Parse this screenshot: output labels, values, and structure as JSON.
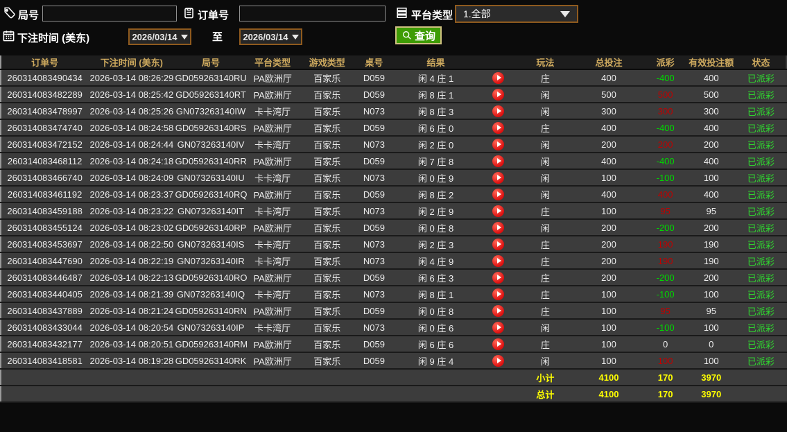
{
  "filters": {
    "round": {
      "label": "局号",
      "value": ""
    },
    "order": {
      "label": "订单号",
      "value": ""
    },
    "platform": {
      "label": "平台类型",
      "selected": "1.全部"
    },
    "bet_time": {
      "label": "下注时间 (美东)",
      "from": "2026/03/14",
      "to_label": "至",
      "to": "2026/03/14"
    },
    "search_label": "查询"
  },
  "table": {
    "columns": [
      "订单号",
      "下注时间 (美东)",
      "局号",
      "平台类型",
      "游戏类型",
      "桌号",
      "结果",
      "",
      "玩法",
      "总投注",
      "派彩",
      "有效投注额",
      "状态"
    ],
    "rows": [
      [
        "260314083490434",
        "2026-03-14 08:26:29",
        "GD059263140RU",
        "PA欧洲厅",
        "百家乐",
        "D059",
        "闲 4 庄 1",
        "庄",
        "400",
        "-400",
        "400",
        "已派彩"
      ],
      [
        "260314083482289",
        "2026-03-14 08:25:42",
        "GD059263140RT",
        "PA欧洲厅",
        "百家乐",
        "D059",
        "闲 8 庄 1",
        "闲",
        "500",
        "500",
        "500",
        "已派彩"
      ],
      [
        "260314083478997",
        "2026-03-14 08:25:26",
        "GN073263140IW",
        "卡卡湾厅",
        "百家乐",
        "N073",
        "闲 8 庄 3",
        "闲",
        "300",
        "300",
        "300",
        "已派彩"
      ],
      [
        "260314083474740",
        "2026-03-14 08:24:58",
        "GD059263140RS",
        "PA欧洲厅",
        "百家乐",
        "D059",
        "闲 6 庄 0",
        "庄",
        "400",
        "-400",
        "400",
        "已派彩"
      ],
      [
        "260314083472152",
        "2026-03-14 08:24:44",
        "GN073263140IV",
        "卡卡湾厅",
        "百家乐",
        "N073",
        "闲 2 庄 0",
        "闲",
        "200",
        "200",
        "200",
        "已派彩"
      ],
      [
        "260314083468112",
        "2026-03-14 08:24:18",
        "GD059263140RR",
        "PA欧洲厅",
        "百家乐",
        "D059",
        "闲 7 庄 8",
        "闲",
        "400",
        "-400",
        "400",
        "已派彩"
      ],
      [
        "260314083466740",
        "2026-03-14 08:24:09",
        "GN073263140IU",
        "卡卡湾厅",
        "百家乐",
        "N073",
        "闲 0 庄 9",
        "闲",
        "100",
        "-100",
        "100",
        "已派彩"
      ],
      [
        "260314083461192",
        "2026-03-14 08:23:37",
        "GD059263140RQ",
        "PA欧洲厅",
        "百家乐",
        "D059",
        "闲 8 庄 2",
        "闲",
        "400",
        "400",
        "400",
        "已派彩"
      ],
      [
        "260314083459188",
        "2026-03-14 08:23:22",
        "GN073263140IT",
        "卡卡湾厅",
        "百家乐",
        "N073",
        "闲 2 庄 9",
        "庄",
        "100",
        "95",
        "95",
        "已派彩"
      ],
      [
        "260314083455124",
        "2026-03-14 08:23:02",
        "GD059263140RP",
        "PA欧洲厅",
        "百家乐",
        "D059",
        "闲 0 庄 8",
        "闲",
        "200",
        "-200",
        "200",
        "已派彩"
      ],
      [
        "260314083453697",
        "2026-03-14 08:22:50",
        "GN073263140IS",
        "卡卡湾厅",
        "百家乐",
        "N073",
        "闲 2 庄 3",
        "庄",
        "200",
        "190",
        "190",
        "已派彩"
      ],
      [
        "260314083447690",
        "2026-03-14 08:22:19",
        "GN073263140IR",
        "卡卡湾厅",
        "百家乐",
        "N073",
        "闲 4 庄 9",
        "庄",
        "200",
        "190",
        "190",
        "已派彩"
      ],
      [
        "260314083446487",
        "2026-03-14 08:22:13",
        "GD059263140RO",
        "PA欧洲厅",
        "百家乐",
        "D059",
        "闲 6 庄 3",
        "庄",
        "200",
        "-200",
        "200",
        "已派彩"
      ],
      [
        "260314083440405",
        "2026-03-14 08:21:39",
        "GN073263140IQ",
        "卡卡湾厅",
        "百家乐",
        "N073",
        "闲 8 庄 1",
        "庄",
        "100",
        "-100",
        "100",
        "已派彩"
      ],
      [
        "260314083437889",
        "2026-03-14 08:21:24",
        "GD059263140RN",
        "PA欧洲厅",
        "百家乐",
        "D059",
        "闲 0 庄 8",
        "庄",
        "100",
        "95",
        "95",
        "已派彩"
      ],
      [
        "260314083433044",
        "2026-03-14 08:20:54",
        "GN073263140IP",
        "卡卡湾厅",
        "百家乐",
        "N073",
        "闲 0 庄 6",
        "闲",
        "100",
        "-100",
        "100",
        "已派彩"
      ],
      [
        "260314083432177",
        "2026-03-14 08:20:51",
        "GD059263140RM",
        "PA欧洲厅",
        "百家乐",
        "D059",
        "闲 6 庄 6",
        "庄",
        "100",
        "0",
        "0",
        "已派彩"
      ],
      [
        "260314083418581",
        "2026-03-14 08:19:28",
        "GD059263140RK",
        "PA欧洲厅",
        "百家乐",
        "D059",
        "闲 9 庄 4",
        "闲",
        "100",
        "100",
        "100",
        "已派彩"
      ]
    ],
    "subtotal": {
      "label": "小计",
      "total_bet": "4100",
      "payout": "170",
      "valid_bet": "3970"
    },
    "grand_total": {
      "label": "总计",
      "total_bet": "4100",
      "payout": "170",
      "valid_bet": "3970"
    }
  },
  "colors": {
    "header_text_gold": "#cda95e",
    "payout_win_red": "#c00000",
    "payout_loss_green": "#00d800",
    "status_green": "#2fd52f",
    "totals_yellow": "#ffff00",
    "search_button_green": "#3e9c05",
    "picker_border_brown": "#8f5a1e",
    "row_background": "#3c3c3c"
  }
}
